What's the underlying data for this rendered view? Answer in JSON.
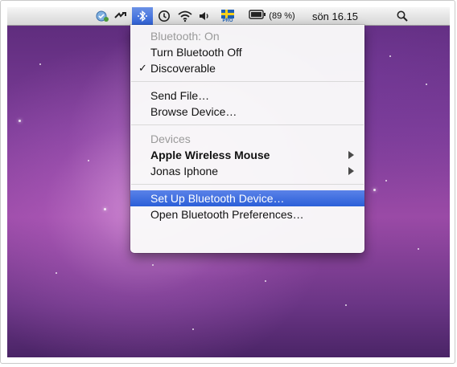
{
  "menubar": {
    "icons": [
      "time-machine-icon",
      "sync-icon",
      "bluetooth-icon",
      "clock-icon",
      "wifi-icon",
      "volume-icon",
      "swedish-flag-input-icon",
      "battery-icon",
      "spotlight-icon"
    ],
    "flag_badge": "PRO",
    "battery_percent": "(89 %)",
    "clock": "sön 16.15"
  },
  "bluetooth_menu": {
    "status": "Bluetooth: On",
    "turn_off": "Turn Bluetooth Off",
    "discoverable": "Discoverable",
    "discoverable_checked": true,
    "check_mark": "✓",
    "send_file": "Send File…",
    "browse_device": "Browse Device…",
    "devices_header": "Devices",
    "devices": [
      {
        "name": "Apple Wireless Mouse",
        "bold": true,
        "has_submenu": true
      },
      {
        "name": "Jonas Iphone",
        "bold": false,
        "has_submenu": true
      }
    ],
    "set_up": "Set Up Bluetooth Device…",
    "open_prefs": "Open Bluetooth Preferences…"
  },
  "colors": {
    "highlight": "#2f62d8",
    "desktop": "#7d3d98"
  }
}
